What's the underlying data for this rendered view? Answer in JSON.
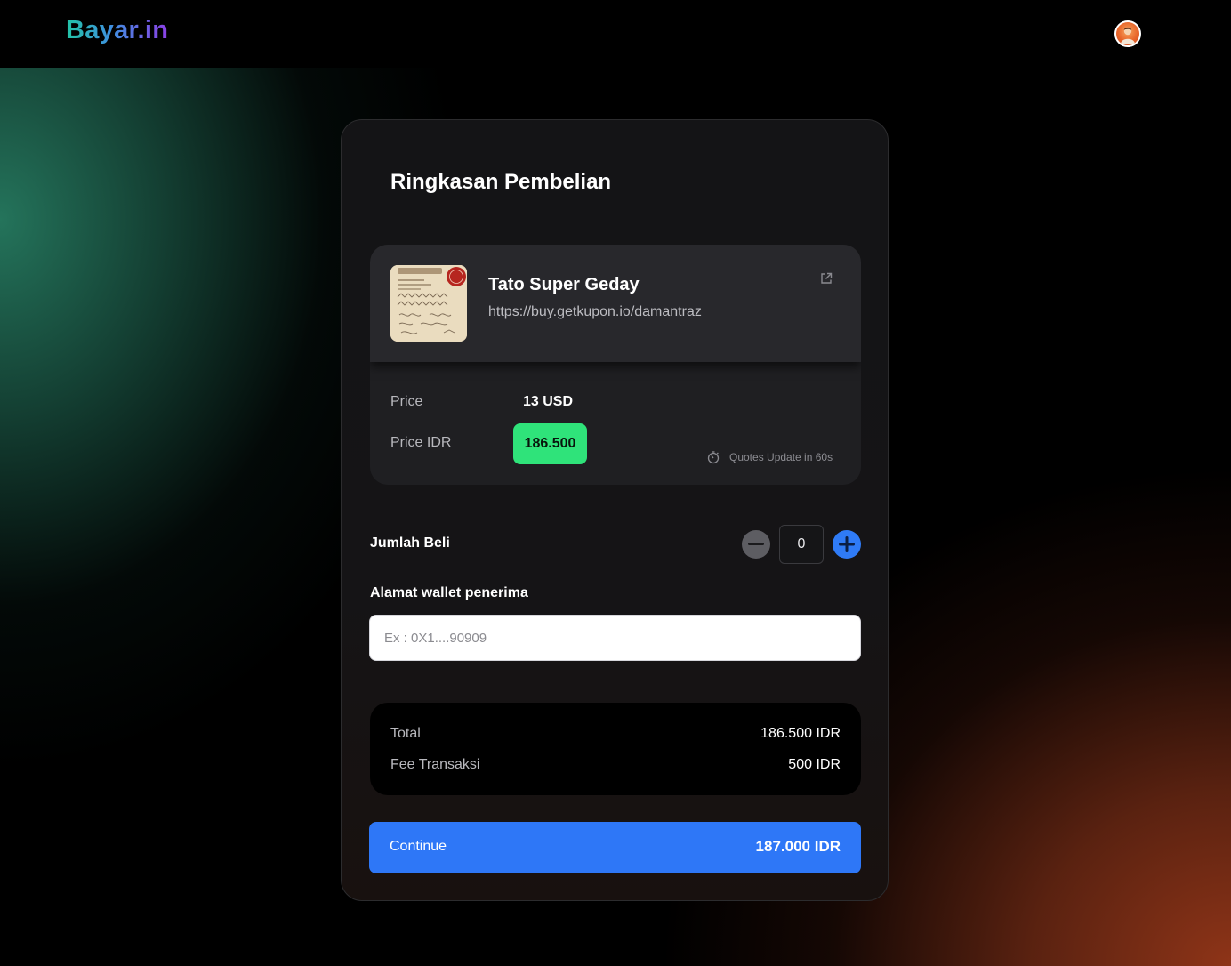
{
  "app": {
    "logo": "Bayar.in"
  },
  "header": {
    "avatar_icon": "user-avatar"
  },
  "card": {
    "title": "Ringkasan Pembelian"
  },
  "product": {
    "name": "Tato Super Geday",
    "url": "https://buy.getkupon.io/damantraz",
    "thumbnail_icon": "product-thumbnail",
    "open_link_icon": "external-link-icon"
  },
  "pricing": {
    "price_label": "Price",
    "price_value": "13 USD",
    "price_idr_label": "Price IDR",
    "price_idr_value": "186.500",
    "quotes_text": "Quotes Update in 60s",
    "quotes_icon": "stopwatch-icon"
  },
  "quantity": {
    "label": "Jumlah Beli",
    "value": "0",
    "minus_icon": "minus-icon",
    "plus_icon": "plus-icon"
  },
  "wallet": {
    "label": "Alamat wallet penerima",
    "placeholder": "Ex : 0X1....90909",
    "value": ""
  },
  "summary": {
    "total_label": "Total",
    "total_value": "186.500 IDR",
    "fee_label": "Fee Transaksi",
    "fee_value": "500 IDR"
  },
  "continue": {
    "label": "Continue",
    "amount": "187.000 IDR"
  },
  "colors": {
    "accent_blue": "#2e77f7",
    "price_badge_green": "#2fe37a",
    "card_background": "#141416",
    "page_background": "#000000"
  }
}
